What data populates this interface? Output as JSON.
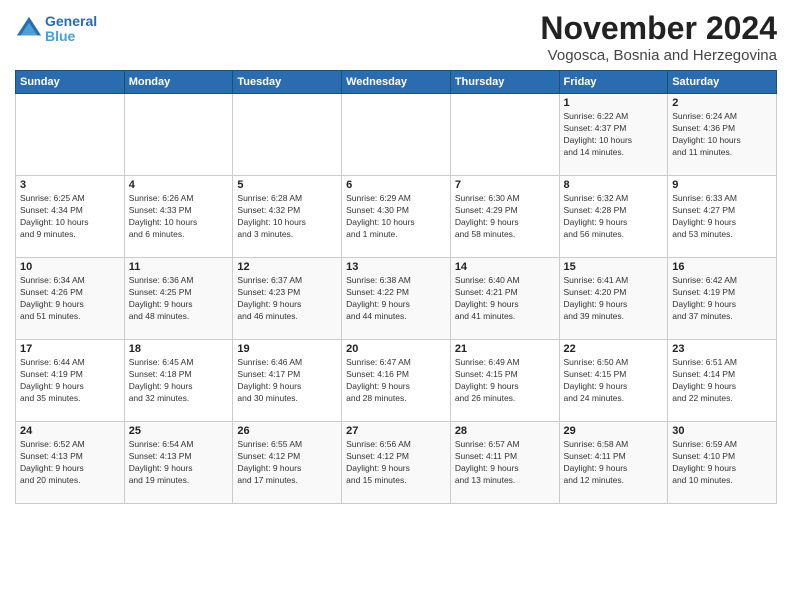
{
  "logo": {
    "line1": "General",
    "line2": "Blue"
  },
  "title": "November 2024",
  "subtitle": "Vogosca, Bosnia and Herzegovina",
  "days_of_week": [
    "Sunday",
    "Monday",
    "Tuesday",
    "Wednesday",
    "Thursday",
    "Friday",
    "Saturday"
  ],
  "weeks": [
    [
      {
        "day": "",
        "info": ""
      },
      {
        "day": "",
        "info": ""
      },
      {
        "day": "",
        "info": ""
      },
      {
        "day": "",
        "info": ""
      },
      {
        "day": "",
        "info": ""
      },
      {
        "day": "1",
        "info": "Sunrise: 6:22 AM\nSunset: 4:37 PM\nDaylight: 10 hours\nand 14 minutes."
      },
      {
        "day": "2",
        "info": "Sunrise: 6:24 AM\nSunset: 4:36 PM\nDaylight: 10 hours\nand 11 minutes."
      }
    ],
    [
      {
        "day": "3",
        "info": "Sunrise: 6:25 AM\nSunset: 4:34 PM\nDaylight: 10 hours\nand 9 minutes."
      },
      {
        "day": "4",
        "info": "Sunrise: 6:26 AM\nSunset: 4:33 PM\nDaylight: 10 hours\nand 6 minutes."
      },
      {
        "day": "5",
        "info": "Sunrise: 6:28 AM\nSunset: 4:32 PM\nDaylight: 10 hours\nand 3 minutes."
      },
      {
        "day": "6",
        "info": "Sunrise: 6:29 AM\nSunset: 4:30 PM\nDaylight: 10 hours\nand 1 minute."
      },
      {
        "day": "7",
        "info": "Sunrise: 6:30 AM\nSunset: 4:29 PM\nDaylight: 9 hours\nand 58 minutes."
      },
      {
        "day": "8",
        "info": "Sunrise: 6:32 AM\nSunset: 4:28 PM\nDaylight: 9 hours\nand 56 minutes."
      },
      {
        "day": "9",
        "info": "Sunrise: 6:33 AM\nSunset: 4:27 PM\nDaylight: 9 hours\nand 53 minutes."
      }
    ],
    [
      {
        "day": "10",
        "info": "Sunrise: 6:34 AM\nSunset: 4:26 PM\nDaylight: 9 hours\nand 51 minutes."
      },
      {
        "day": "11",
        "info": "Sunrise: 6:36 AM\nSunset: 4:25 PM\nDaylight: 9 hours\nand 48 minutes."
      },
      {
        "day": "12",
        "info": "Sunrise: 6:37 AM\nSunset: 4:23 PM\nDaylight: 9 hours\nand 46 minutes."
      },
      {
        "day": "13",
        "info": "Sunrise: 6:38 AM\nSunset: 4:22 PM\nDaylight: 9 hours\nand 44 minutes."
      },
      {
        "day": "14",
        "info": "Sunrise: 6:40 AM\nSunset: 4:21 PM\nDaylight: 9 hours\nand 41 minutes."
      },
      {
        "day": "15",
        "info": "Sunrise: 6:41 AM\nSunset: 4:20 PM\nDaylight: 9 hours\nand 39 minutes."
      },
      {
        "day": "16",
        "info": "Sunrise: 6:42 AM\nSunset: 4:19 PM\nDaylight: 9 hours\nand 37 minutes."
      }
    ],
    [
      {
        "day": "17",
        "info": "Sunrise: 6:44 AM\nSunset: 4:19 PM\nDaylight: 9 hours\nand 35 minutes."
      },
      {
        "day": "18",
        "info": "Sunrise: 6:45 AM\nSunset: 4:18 PM\nDaylight: 9 hours\nand 32 minutes."
      },
      {
        "day": "19",
        "info": "Sunrise: 6:46 AM\nSunset: 4:17 PM\nDaylight: 9 hours\nand 30 minutes."
      },
      {
        "day": "20",
        "info": "Sunrise: 6:47 AM\nSunset: 4:16 PM\nDaylight: 9 hours\nand 28 minutes."
      },
      {
        "day": "21",
        "info": "Sunrise: 6:49 AM\nSunset: 4:15 PM\nDaylight: 9 hours\nand 26 minutes."
      },
      {
        "day": "22",
        "info": "Sunrise: 6:50 AM\nSunset: 4:15 PM\nDaylight: 9 hours\nand 24 minutes."
      },
      {
        "day": "23",
        "info": "Sunrise: 6:51 AM\nSunset: 4:14 PM\nDaylight: 9 hours\nand 22 minutes."
      }
    ],
    [
      {
        "day": "24",
        "info": "Sunrise: 6:52 AM\nSunset: 4:13 PM\nDaylight: 9 hours\nand 20 minutes."
      },
      {
        "day": "25",
        "info": "Sunrise: 6:54 AM\nSunset: 4:13 PM\nDaylight: 9 hours\nand 19 minutes."
      },
      {
        "day": "26",
        "info": "Sunrise: 6:55 AM\nSunset: 4:12 PM\nDaylight: 9 hours\nand 17 minutes."
      },
      {
        "day": "27",
        "info": "Sunrise: 6:56 AM\nSunset: 4:12 PM\nDaylight: 9 hours\nand 15 minutes."
      },
      {
        "day": "28",
        "info": "Sunrise: 6:57 AM\nSunset: 4:11 PM\nDaylight: 9 hours\nand 13 minutes."
      },
      {
        "day": "29",
        "info": "Sunrise: 6:58 AM\nSunset: 4:11 PM\nDaylight: 9 hours\nand 12 minutes."
      },
      {
        "day": "30",
        "info": "Sunrise: 6:59 AM\nSunset: 4:10 PM\nDaylight: 9 hours\nand 10 minutes."
      }
    ]
  ]
}
